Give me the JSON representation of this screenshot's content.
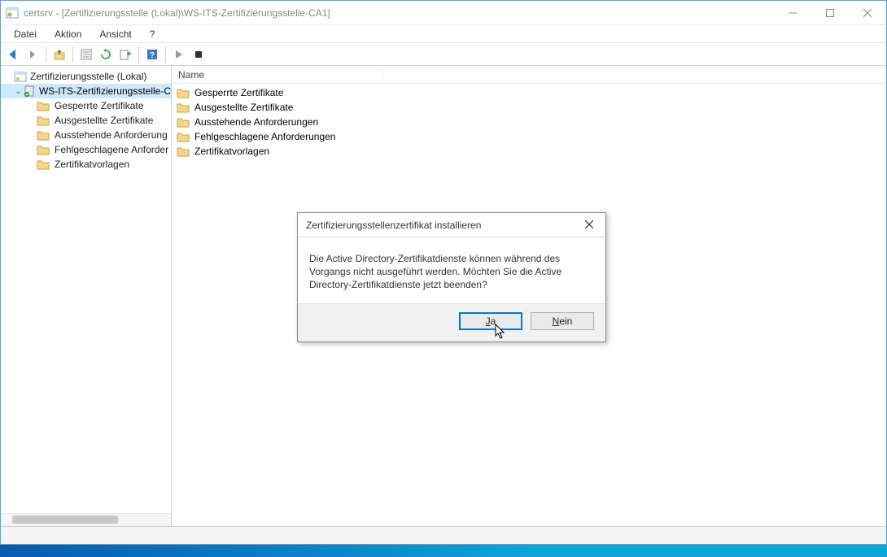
{
  "titlebar": {
    "title": "certsrv - [Zertifizierungsstelle (Lokal)\\WS-ITS-Zertifizierungsstelle-CA1]"
  },
  "menubar": {
    "items": [
      "Datei",
      "Aktion",
      "Ansicht",
      "?"
    ]
  },
  "tree": {
    "root": "Zertifizierungsstelle (Lokal)",
    "ca": "WS-ITS-Zertifizierungsstelle-C",
    "children": [
      "Gesperrte Zertifikate",
      "Ausgestellte Zertifikate",
      "Ausstehende Anforderung",
      "Fehlgeschlagene Anforder",
      "Zertifikatvorlagen"
    ]
  },
  "list": {
    "header": "Name",
    "items": [
      "Gesperrte Zertifikate",
      "Ausgestellte Zertifikate",
      "Ausstehende Anforderungen",
      "Fehlgeschlagene Anforderungen",
      "Zertifikatvorlagen"
    ]
  },
  "dialog": {
    "title": "Zertifizierungsstellenzertifikat installieren",
    "message": "Die Active Directory-Zertifikatdienste können während des Vorgangs nicht ausgeführt werden. Möchten Sie die Active Directory-Zertifikatdienste jetzt beenden?",
    "yes": "Ja",
    "no": "Nein"
  }
}
